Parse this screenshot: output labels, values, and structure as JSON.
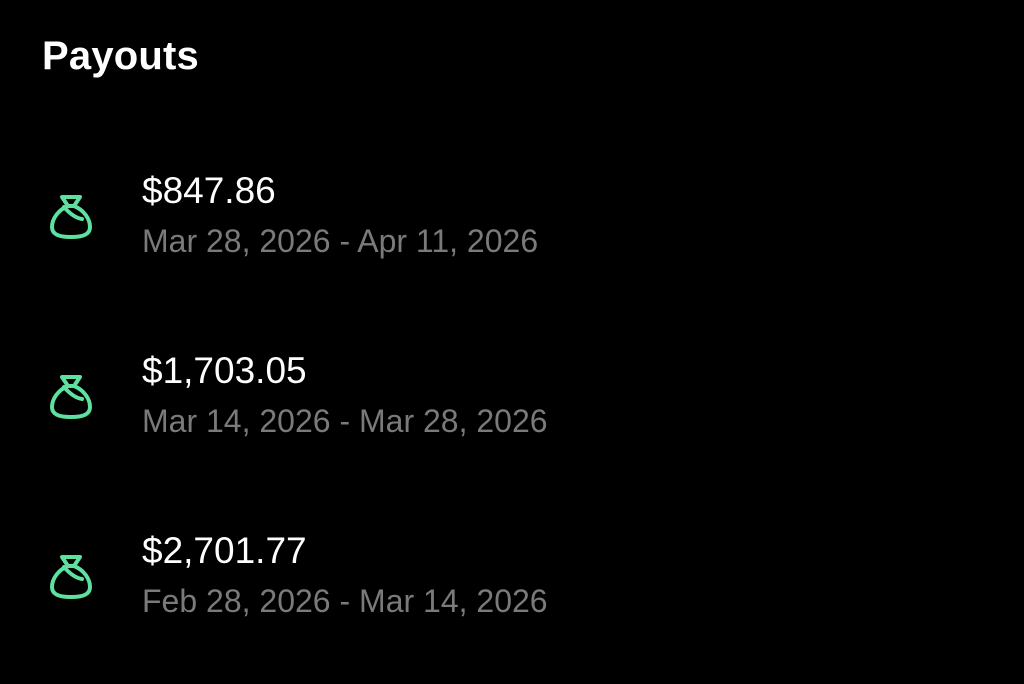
{
  "header": {
    "title": "Payouts"
  },
  "colors": {
    "background": "#000000",
    "accent_icon": "#5ee0a0",
    "primary_text": "#ffffff",
    "secondary_text": "#7a7a7a"
  },
  "payouts": [
    {
      "icon": "money-bag-icon",
      "amount": "$847.86",
      "period": "Mar 28, 2026 - Apr 11, 2026"
    },
    {
      "icon": "money-bag-icon",
      "amount": "$1,703.05",
      "period": "Mar 14, 2026 - Mar 28, 2026"
    },
    {
      "icon": "money-bag-icon",
      "amount": "$2,701.77",
      "period": "Feb 28, 2026 - Mar 14, 2026"
    }
  ]
}
